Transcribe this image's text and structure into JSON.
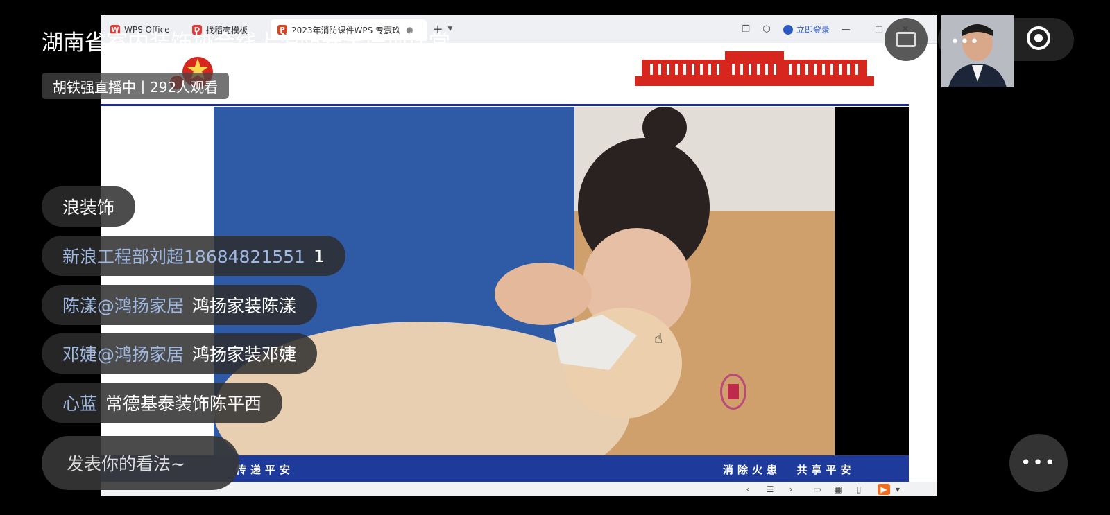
{
  "live": {
    "title": "湖南省室内装饰协会线上消防安全培训课堂",
    "host_status": "胡铁强直播中丨292人观看",
    "comment_placeholder": "发表你的看法~"
  },
  "comments": [
    {
      "user": "",
      "text": "浪装饰"
    },
    {
      "user": "新浪工程部刘超18684821551",
      "text": "1"
    },
    {
      "user": "陈漾@鸿扬家居",
      "text": "鸿扬家装陈漾"
    },
    {
      "user": "邓婕@鸿扬家居",
      "text": "鸿扬家装邓婕"
    },
    {
      "user": "心蓝",
      "text": "常德基泰装饰陈平西"
    }
  ],
  "wps": {
    "tabs": [
      {
        "label": "WPS Office",
        "icon": "wps-logo-icon",
        "color": "#e53935"
      },
      {
        "label": "找稻壳模板",
        "icon": "docer-icon",
        "color": "#e53935"
      },
      {
        "label": "2023年消防课件WPS  专壹玖",
        "icon": "presentation-icon",
        "color": "#d24726"
      }
    ],
    "login_label": "立即登录",
    "accent": "#1e3a9b"
  },
  "slide": {
    "footer_left": "传递平安",
    "footer_right": "消除火患  共享平安"
  }
}
